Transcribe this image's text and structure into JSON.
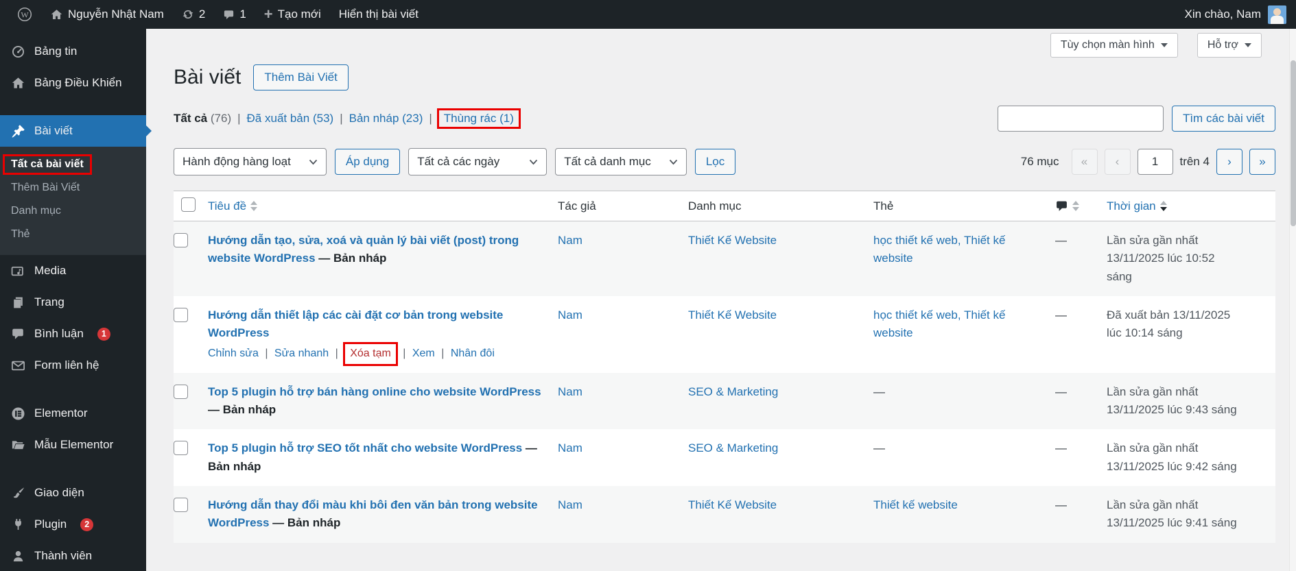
{
  "admin_bar": {
    "site_name": "Nguyễn Nhật Nam",
    "updates_count": "2",
    "comments_count": "1",
    "new_label": "Tạo mới",
    "view_posts_label": "Hiển thị bài viết",
    "greeting": "Xin chào, Nam"
  },
  "screen_meta": {
    "options": "Tùy chọn màn hình",
    "help": "Hỗ trợ"
  },
  "sidebar": {
    "dashboard": "Bảng tin",
    "control_panel": "Bảng Điều Khiển",
    "posts": "Bài viết",
    "all_posts": "Tất cả bài viết",
    "add_post": "Thêm Bài Viết",
    "categories": "Danh mục",
    "tags": "Thẻ",
    "media": "Media",
    "pages": "Trang",
    "comments": "Bình luận",
    "comments_badge": "1",
    "contact_form": "Form liên hệ",
    "elementor": "Elementor",
    "elementor_templates": "Mẫu Elementor",
    "appearance": "Giao diện",
    "plugins": "Plugin",
    "plugins_badge": "2",
    "users": "Thành viên"
  },
  "page": {
    "title": "Bài viết",
    "add_new": "Thêm Bài Viết"
  },
  "filters": {
    "all": {
      "label": "Tất cả",
      "count": "(76)"
    },
    "published": {
      "label": "Đã xuất bản",
      "count": "(53)"
    },
    "draft": {
      "label": "Bản nháp",
      "count": "(23)"
    },
    "trash": {
      "label": "Thùng rác",
      "count": "(1)"
    }
  },
  "search": {
    "button": "Tìm các bài viết"
  },
  "toolbar": {
    "bulk_actions": "Hành động hàng loạt",
    "apply": "Áp dụng",
    "all_dates": "Tất cả các ngày",
    "all_categories": "Tất cả danh mục",
    "filter": "Lọc",
    "items_count": "76 mục",
    "page_value": "1",
    "page_of": "trên 4",
    "pg_first": "«",
    "pg_prev": "‹",
    "pg_next": "›",
    "pg_last": "»"
  },
  "table": {
    "headers": {
      "title": "Tiêu đề",
      "author": "Tác giả",
      "category": "Danh mục",
      "tags": "Thẻ",
      "date": "Thời gian"
    },
    "rows": [
      {
        "title": "Hướng dẫn tạo, sửa, xoá và quản lý bài viết (post) trong website WordPress",
        "state": " — Bản nháp",
        "author": "Nam",
        "category": "Thiết Kế Website",
        "tags": "học thiết kế web, Thiết kế website",
        "comments": "—",
        "date_status": "Lần sửa gần nhất",
        "date": "13/11/2025 lúc 10:52 sáng"
      },
      {
        "title": "Hướng dẫn thiết lập các cài đặt cơ bản trong website WordPress",
        "state": "",
        "author": "Nam",
        "category": "Thiết Kế Website",
        "tags": "học thiết kế web, Thiết kế website",
        "comments": "—",
        "date_status": "Đã xuất bản",
        "date": "13/11/2025 lúc 10:14 sáng",
        "actions": {
          "edit": "Chỉnh sửa",
          "quick": "Sửa nhanh",
          "trash": "Xóa tạm",
          "view": "Xem",
          "duplicate": "Nhân đôi"
        }
      },
      {
        "title": "Top 5 plugin hỗ trợ bán hàng online cho website WordPress",
        "state": " — Bản nháp",
        "author": "Nam",
        "category": "SEO & Marketing",
        "tags": "—",
        "comments": "—",
        "date_status": "Lần sửa gần nhất",
        "date": "13/11/2025 lúc 9:43 sáng"
      },
      {
        "title": "Top 5 plugin hỗ trợ SEO tốt nhất cho website WordPress",
        "state": " — Bản nháp",
        "author": "Nam",
        "category": "SEO & Marketing",
        "tags": "—",
        "comments": "—",
        "date_status": "Lần sửa gần nhất",
        "date": "13/11/2025 lúc 9:42 sáng"
      },
      {
        "title": "Hướng dẫn thay đổi màu khi bôi đen văn bản trong website WordPress",
        "state": " — Bản nháp",
        "author": "Nam",
        "category": "Thiết Kế Website",
        "tags": "Thiết kế website",
        "comments": "—",
        "date_status": "Lần sửa gần nhất",
        "date": "13/11/2025 lúc 9:41 sáng"
      }
    ]
  }
}
